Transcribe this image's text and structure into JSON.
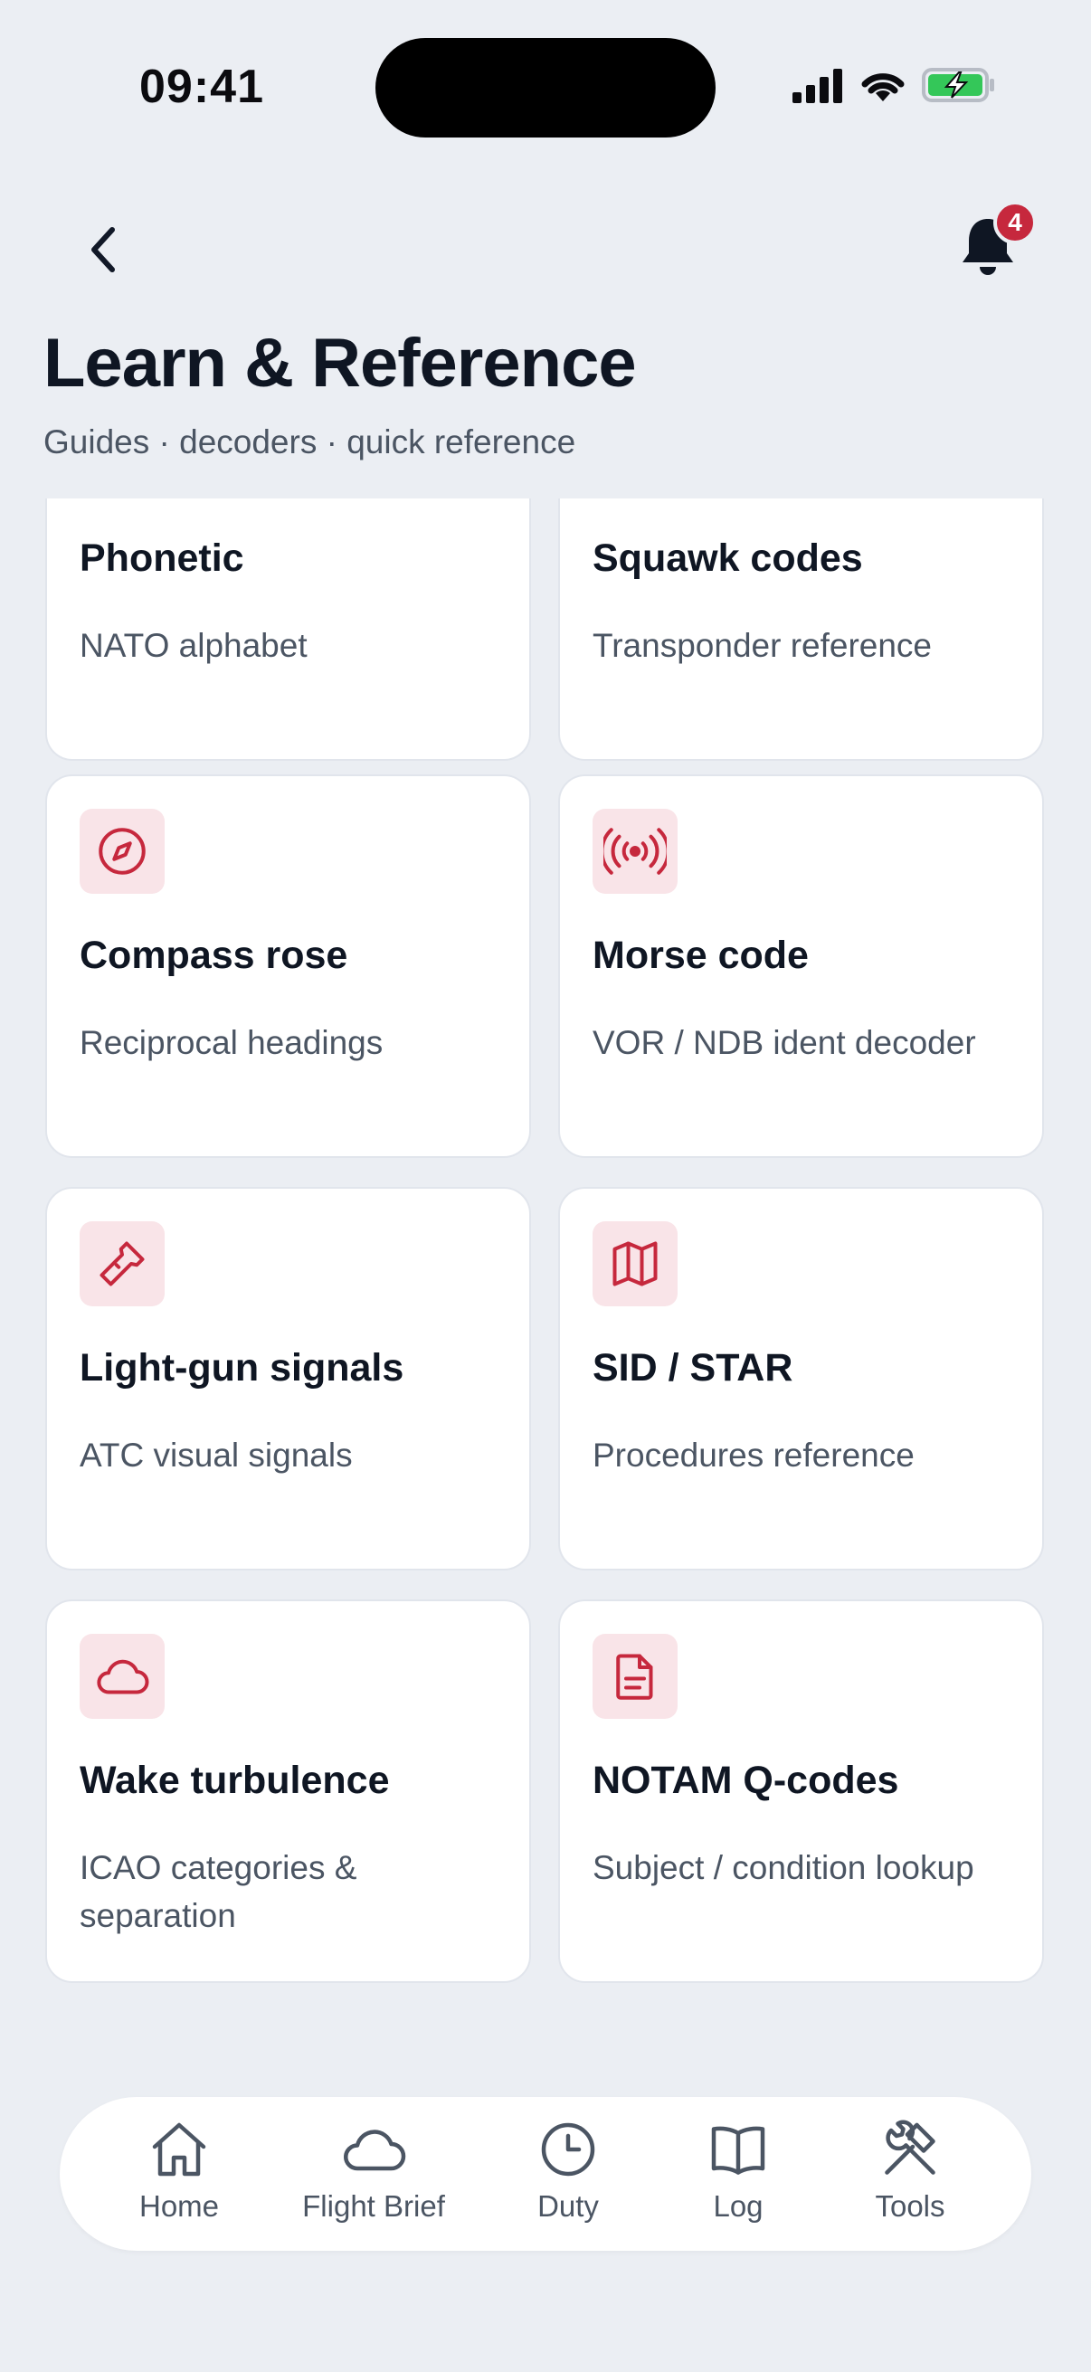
{
  "status_bar": {
    "time": "09:41",
    "icons": [
      "signal-icon",
      "wifi-icon",
      "battery-charging-icon"
    ]
  },
  "header": {
    "back_icon": "chevron-left-icon",
    "notifications": {
      "icon": "bell-icon",
      "count": "4"
    },
    "title": "Learn & Reference",
    "subtitle": "Guides · decoders · quick reference"
  },
  "cards": [
    {
      "title": "Phonetic",
      "description": "NATO alphabet",
      "icon": "megaphone-icon"
    },
    {
      "title": "Squawk codes",
      "description": "Transponder reference",
      "icon": "broadcast-icon"
    },
    {
      "title": "Compass rose",
      "description": "Reciprocal headings",
      "icon": "compass-icon"
    },
    {
      "title": "Morse code",
      "description": "VOR / NDB ident decoder",
      "icon": "broadcast-icon"
    },
    {
      "title": "Light-gun signals",
      "description": "ATC visual signals",
      "icon": "flashlight-icon"
    },
    {
      "title": "SID / STAR",
      "description": "Procedures reference",
      "icon": "map-icon"
    },
    {
      "title": "Wake turbulence",
      "description": "ICAO categories & separation",
      "icon": "cloud-icon"
    },
    {
      "title": "NOTAM Q-codes",
      "description": "Subject / condition lookup",
      "icon": "document-icon"
    }
  ],
  "bottom_nav": [
    {
      "label": "Home",
      "icon": "home-icon"
    },
    {
      "label": "Flight Brief",
      "icon": "cloud-icon"
    },
    {
      "label": "Duty",
      "icon": "clock-icon"
    },
    {
      "label": "Log",
      "icon": "book-icon"
    },
    {
      "label": "Tools",
      "icon": "tools-icon"
    }
  ],
  "colors": {
    "accent": "#c6283d",
    "icon_tile": "#f9e4e8",
    "background": "#ebeef3",
    "text_primary": "#0f1623",
    "text_secondary": "#4b5563",
    "battery_fill": "#34c759"
  }
}
